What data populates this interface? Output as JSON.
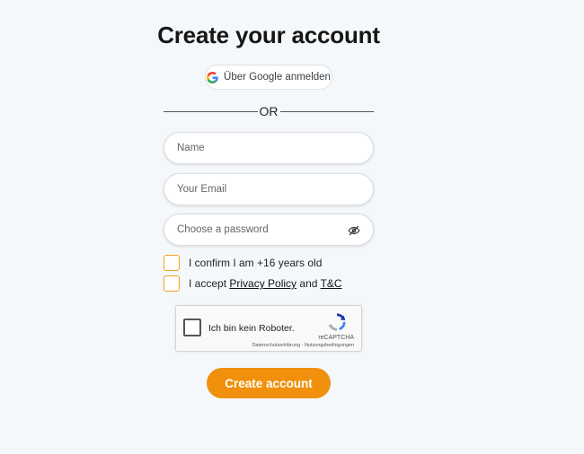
{
  "page": {
    "title": "Create your account"
  },
  "google": {
    "label": "Über Google anmelden",
    "icon": "google-icon"
  },
  "divider": {
    "label": "OR"
  },
  "form": {
    "name_placeholder": "Name",
    "email_placeholder": "Your Email",
    "password_placeholder": "Choose a password",
    "password_toggle_icon": "eye-off-icon",
    "age_confirm_label": "I confirm I am +16 years old",
    "accept_prefix": "I accept",
    "privacy_link": "Privacy Policy",
    "and_text": "and",
    "terms_link": "T&C",
    "checkbox_accent": "#f0a020"
  },
  "captcha": {
    "label": "Ich bin kein Roboter.",
    "brand": "reCAPTCHA",
    "links": "Datenschutzerklärung - Nutzungsbedingungen"
  },
  "submit": {
    "label": "Create account",
    "color": "#f0900c"
  }
}
